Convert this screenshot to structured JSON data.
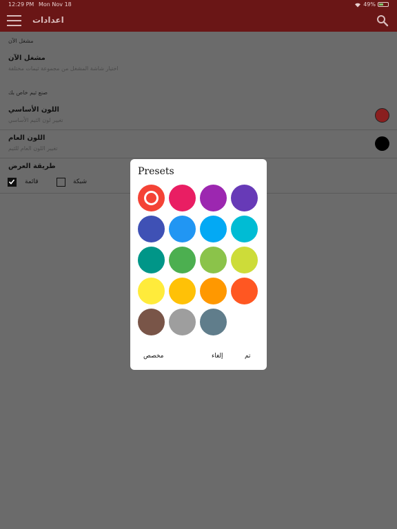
{
  "status_bar": {
    "time": "12:29 PM",
    "date": "Mon Nov 18",
    "battery": "49%"
  },
  "app_bar": {
    "title": "اعدادات",
    "menu_icon": "hamburger-menu-icon",
    "search_icon": "search-icon"
  },
  "settings": {
    "section1_header": "مشغل الآن",
    "now_playing": {
      "title": "مشغل الآن",
      "subtitle": "اختيار شاشة المشغل من مجموعة ثيمات مختلفة"
    },
    "section2_header": "صنع ثيم خاص بك",
    "primary_color": {
      "title": "اللون الأساسي",
      "subtitle": "تغيير لون الثيم الأساسي",
      "color": "#c62828"
    },
    "general_color": {
      "title": "اللون العام",
      "subtitle": "تغيير اللون العام للثيم",
      "color": "#000000"
    },
    "display_mode": {
      "title": "طريقة العرض",
      "list_label": "قائمة",
      "grid_label": "شبكة",
      "list_checked": true,
      "grid_checked": false
    }
  },
  "dialog": {
    "title": "Presets",
    "selected_index": 0,
    "colors": [
      "#f44336",
      "#e91e63",
      "#9c27b0",
      "#673ab7",
      "#3f51b5",
      "#2196f3",
      "#03a9f4",
      "#00bcd4",
      "#009688",
      "#4caf50",
      "#8bc34a",
      "#cddc39",
      "#ffeb3b",
      "#ffc107",
      "#ff9800",
      "#ff5722",
      "#795548",
      "#9e9e9e",
      "#607d8b"
    ],
    "custom_label": "مخصص",
    "cancel_label": "إلغاء",
    "done_label": "تم"
  }
}
